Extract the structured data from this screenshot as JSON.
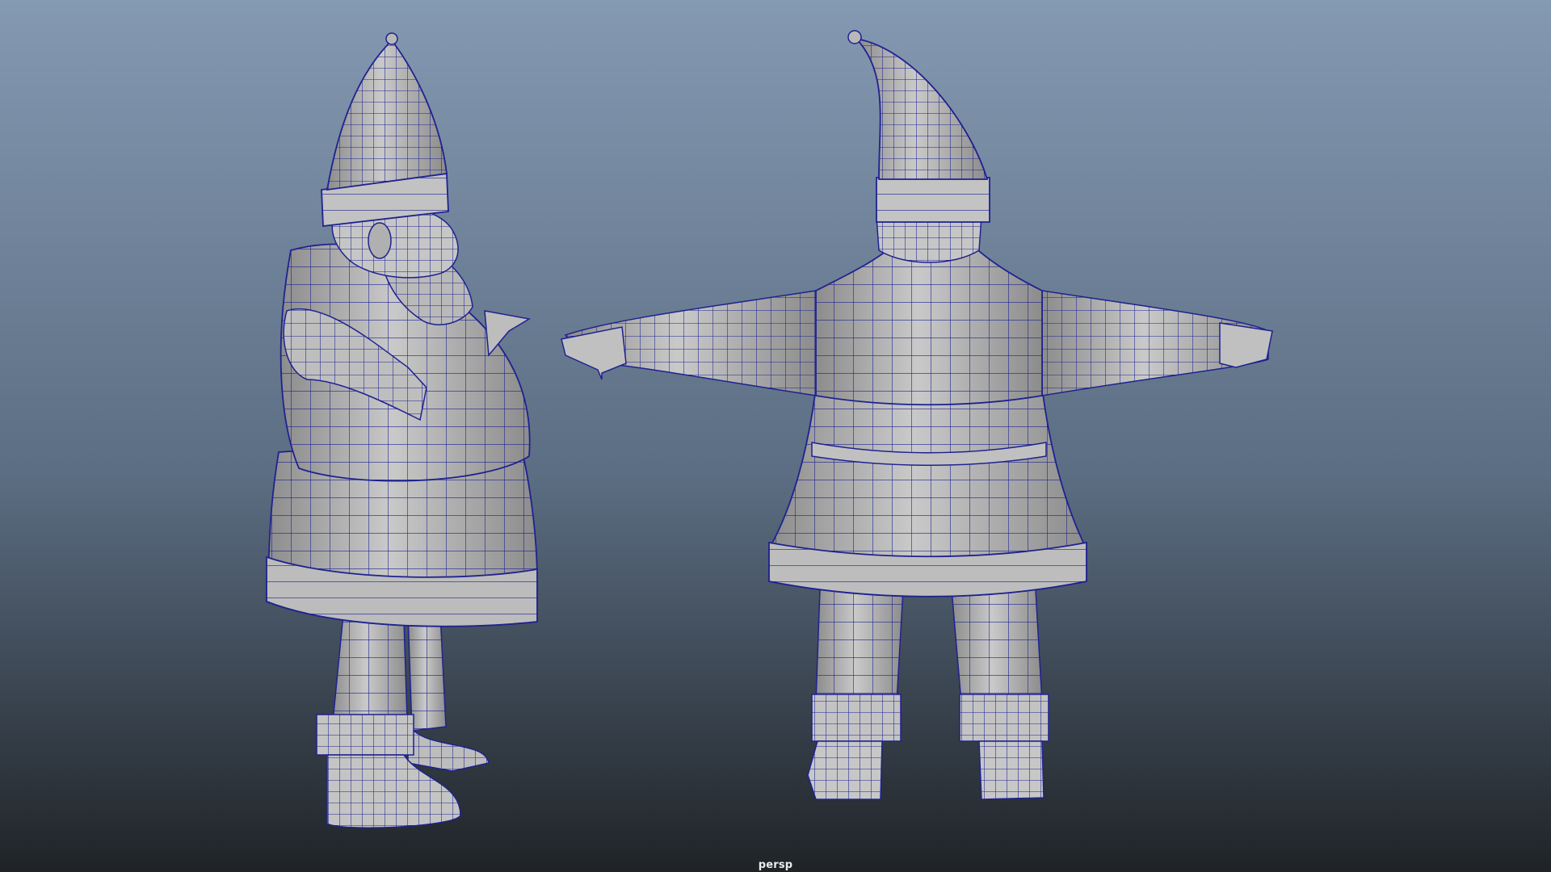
{
  "viewport": {
    "camera_label": "persp",
    "background_top": "#8499b2",
    "background_bottom": "#1f2327"
  },
  "model": {
    "surface_color": "#c9c9c9",
    "surface_shadow_color": "#8c8c8c",
    "wireframe_color": "#1e2290"
  },
  "views": [
    {
      "name": "side"
    },
    {
      "name": "back"
    }
  ]
}
